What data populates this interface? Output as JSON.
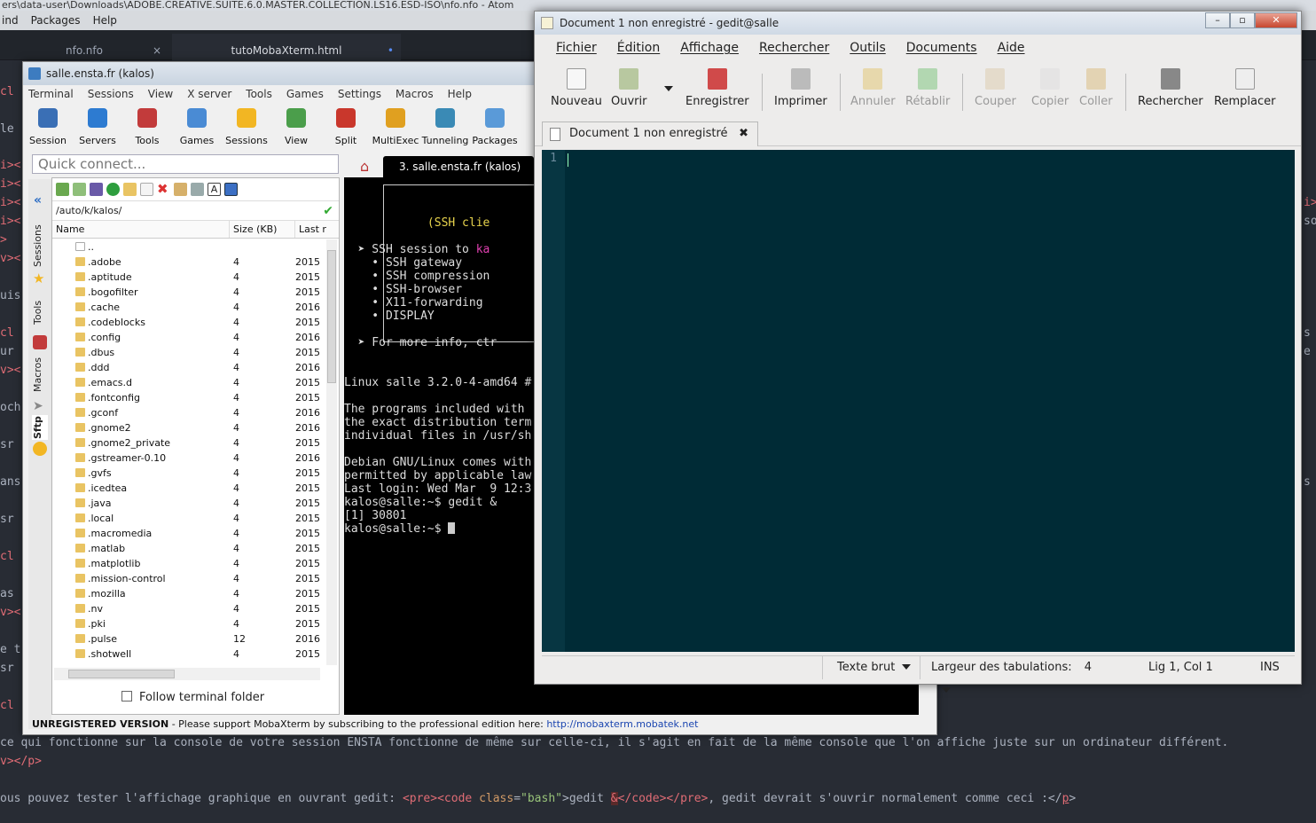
{
  "atom": {
    "title": "ers\\data-user\\Downloads\\ADOBE.CREATIVE.SUITE.6.0.MASTER.COLLECTION.LS16.ESD-ISO\\nfo.nfo - Atom",
    "menu": [
      "ind",
      "Packages",
      "Help"
    ],
    "tabs": [
      {
        "label": "nfo.nfo",
        "close": "×"
      },
      {
        "label": "tutoMobaXterm.html",
        "close": "•"
      }
    ],
    "left_fragments": [
      "cl",
      "le",
      "i><",
      "i><",
      "i><",
      "i><",
      ">",
      "v><",
      "uis",
      "cl",
      "ur",
      "v><",
      "och",
      "sr",
      "ans",
      "sr",
      "cl",
      "as",
      "v><",
      "e t",
      "sr",
      "cl"
    ],
    "right_fragments": [
      "i>",
      "so",
      "s",
      "e",
      "s"
    ],
    "line1": " ce qui fonctionne sur la console de votre session ENSTA fonctionne de même sur celle-ci, il s'agit en fait de la même console que l'on affiche juste sur un ordinateur différent.",
    "line2": "v></p>",
    "line3_parts": [
      "ous pouvez tester l'affichage graphique en ouvrant gedit: ",
      "<pre>",
      "<code ",
      "class",
      "=",
      "\"bash\"",
      ">gedit ",
      "&",
      "</code>",
      "</pre>",
      ", gedit devrait s'ouvrir normalement comme ceci :</",
      "p",
      ">"
    ]
  },
  "moba": {
    "title": "salle.ensta.fr (kalos)",
    "menu": [
      "Terminal",
      "Sessions",
      "View",
      "X server",
      "Tools",
      "Games",
      "Settings",
      "Macros",
      "Help"
    ],
    "toolbar": [
      "Session",
      "Servers",
      "Tools",
      "Games",
      "Sessions",
      "View",
      "Split",
      "MultiExec",
      "Tunneling",
      "Packages"
    ],
    "toolbar_colors": [
      "#3a6fb5",
      "#2d7bd1",
      "#c23b3b",
      "#4a8bd4",
      "#f2b623",
      "#4b9e4b",
      "#c9372c",
      "#e0a020",
      "#3a8ab5",
      "#5a9ad8"
    ],
    "quick_connect": "Quick connect...",
    "side_tabs": [
      "Sessions",
      "Tools",
      "Macros",
      "Sftp"
    ],
    "sftp": {
      "path": "/auto/k/kalos/",
      "columns": [
        "Name",
        "Size (KB)",
        "Last r"
      ],
      "rows": [
        {
          "name": "..",
          "size": "",
          "date": ""
        },
        {
          "name": ".adobe",
          "size": "4",
          "date": "2015"
        },
        {
          "name": ".aptitude",
          "size": "4",
          "date": "2015"
        },
        {
          "name": ".bogofilter",
          "size": "4",
          "date": "2015"
        },
        {
          "name": ".cache",
          "size": "4",
          "date": "2016"
        },
        {
          "name": ".codeblocks",
          "size": "4",
          "date": "2015"
        },
        {
          "name": ".config",
          "size": "4",
          "date": "2016"
        },
        {
          "name": ".dbus",
          "size": "4",
          "date": "2015"
        },
        {
          "name": ".ddd",
          "size": "4",
          "date": "2016"
        },
        {
          "name": ".emacs.d",
          "size": "4",
          "date": "2015"
        },
        {
          "name": ".fontconfig",
          "size": "4",
          "date": "2015"
        },
        {
          "name": ".gconf",
          "size": "4",
          "date": "2016"
        },
        {
          "name": ".gnome2",
          "size": "4",
          "date": "2016"
        },
        {
          "name": ".gnome2_private",
          "size": "4",
          "date": "2015"
        },
        {
          "name": ".gstreamer-0.10",
          "size": "4",
          "date": "2016"
        },
        {
          "name": ".gvfs",
          "size": "4",
          "date": "2015"
        },
        {
          "name": ".icedtea",
          "size": "4",
          "date": "2015"
        },
        {
          "name": ".java",
          "size": "4",
          "date": "2015"
        },
        {
          "name": ".local",
          "size": "4",
          "date": "2015"
        },
        {
          "name": ".macromedia",
          "size": "4",
          "date": "2015"
        },
        {
          "name": ".matlab",
          "size": "4",
          "date": "2015"
        },
        {
          "name": ".matplotlib",
          "size": "4",
          "date": "2015"
        },
        {
          "name": ".mission-control",
          "size": "4",
          "date": "2015"
        },
        {
          "name": ".mozilla",
          "size": "4",
          "date": "2015"
        },
        {
          "name": ".nv",
          "size": "4",
          "date": "2015"
        },
        {
          "name": ".pki",
          "size": "4",
          "date": "2015"
        },
        {
          "name": ".pulse",
          "size": "12",
          "date": "2016"
        },
        {
          "name": ".shotwell",
          "size": "4",
          "date": "2015"
        }
      ],
      "follow_label": "Follow terminal folder"
    },
    "terminal_tab": "3. salle.ensta.fr (kalos)",
    "terminal_lines": [
      "            (SSH clie",
      "",
      "  ➤ SSH session to ",
      "    • SSH gateway",
      "    • SSH compression",
      "    • SSH-browser",
      "    • X11-forwarding",
      "    • DISPLAY",
      "",
      "  ➤ For more info, ctr",
      "",
      "",
      "Linux salle 3.2.0-4-amd64 #",
      "",
      "The programs included with",
      "the exact distribution term",
      "individual files in /usr/sh",
      "",
      "Debian GNU/Linux comes with",
      "permitted by applicable law",
      "Last login: Wed Mar  9 12:3",
      "kalos@salle:~$ gedit &",
      "[1] 30801",
      "kalos@salle:~$ "
    ],
    "ssh_user_fragment": "ka",
    "unregistered": "UNREGISTERED VERSION",
    "support_text": "  -  Please support MobaXterm by subscribing to the professional edition here:  ",
    "support_link": "http://mobaxterm.mobatek.net"
  },
  "gedit": {
    "title": "Document 1 non enregistré - gedit@salle",
    "window_buttons": [
      "–",
      "▫",
      "✕"
    ],
    "menu": [
      "Fichier",
      "Édition",
      "Affichage",
      "Rechercher",
      "Outils",
      "Documents",
      "Aide"
    ],
    "toolbar": [
      {
        "label": "Nouveau",
        "enabled": true
      },
      {
        "label": "Ouvrir",
        "enabled": true
      },
      {
        "label": "Enregistrer",
        "enabled": true
      },
      {
        "label": "Imprimer",
        "enabled": true
      },
      {
        "label": "Annuler",
        "enabled": false
      },
      {
        "label": "Rétablir",
        "enabled": false
      },
      {
        "label": "Couper",
        "enabled": false
      },
      {
        "label": "Copier",
        "enabled": false
      },
      {
        "label": "Coller",
        "enabled": false
      },
      {
        "label": "Rechercher",
        "enabled": true
      },
      {
        "label": "Remplacer",
        "enabled": true
      }
    ],
    "tab_label": "Document 1 non enregistré",
    "tab_close": "✖",
    "line_number": "1",
    "status": {
      "mode": "Texte brut",
      "tab_width_label": "Largeur des tabulations:",
      "tab_width": "4",
      "position": "Lig 1, Col 1",
      "insert_mode": "INS"
    },
    "editor_bg": "#002b36"
  }
}
